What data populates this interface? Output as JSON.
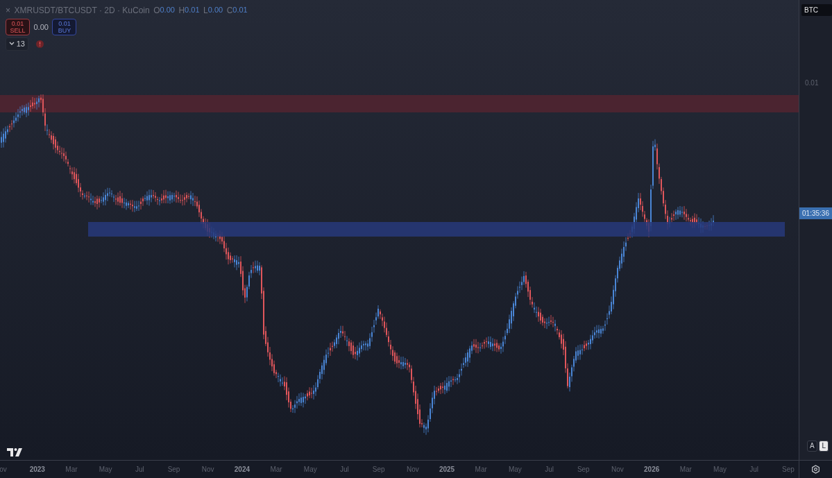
{
  "header": {
    "close": "×",
    "title": "XMRUSDT/BTCUSDT · 2D · KuCoin",
    "ohlc": [
      {
        "key": "O",
        "value": "0.00"
      },
      {
        "key": "H",
        "value": "0.01"
      },
      {
        "key": "L",
        "value": "0.00"
      },
      {
        "key": "C",
        "value": "0.01"
      }
    ]
  },
  "trade": {
    "sell": {
      "price": "0.01",
      "label": "SELL"
    },
    "spread": "0.00",
    "buy": {
      "price": "0.01",
      "label": "BUY"
    }
  },
  "indicators": {
    "count": "13",
    "warning": true
  },
  "price_axis": {
    "currency": "BTC",
    "ticks": [
      "0.01"
    ],
    "countdown": "01:35:36"
  },
  "time_axis": [
    {
      "text": "ov",
      "major": false
    },
    {
      "text": "2023",
      "major": true
    },
    {
      "text": "Mar",
      "major": false
    },
    {
      "text": "May",
      "major": false
    },
    {
      "text": "Jul",
      "major": false
    },
    {
      "text": "Sep",
      "major": false
    },
    {
      "text": "Nov",
      "major": false
    },
    {
      "text": "2024",
      "major": true
    },
    {
      "text": "Mar",
      "major": false
    },
    {
      "text": "May",
      "major": false
    },
    {
      "text": "Jul",
      "major": false
    },
    {
      "text": "Sep",
      "major": false
    },
    {
      "text": "Nov",
      "major": false
    },
    {
      "text": "2025",
      "major": true
    },
    {
      "text": "Mar",
      "major": false
    },
    {
      "text": "May",
      "major": false
    },
    {
      "text": "Jul",
      "major": false
    },
    {
      "text": "Sep",
      "major": false
    },
    {
      "text": "Nov",
      "major": false
    },
    {
      "text": "2026",
      "major": true
    },
    {
      "text": "Mar",
      "major": false
    },
    {
      "text": "May",
      "major": false
    },
    {
      "text": "Jul",
      "major": false
    },
    {
      "text": "Sep",
      "major": false
    }
  ],
  "scale_buttons": [
    {
      "label": "A",
      "selected": false
    },
    {
      "label": "L",
      "selected": true
    }
  ]
}
